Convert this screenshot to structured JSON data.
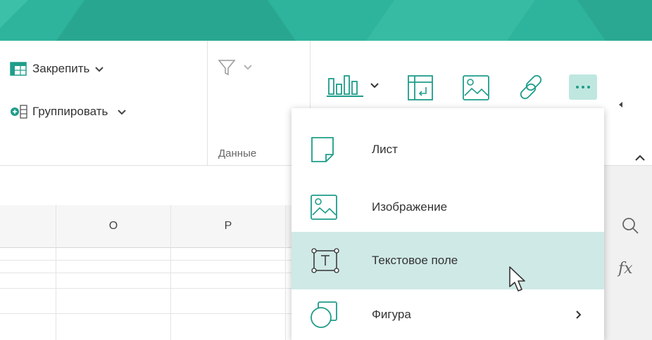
{
  "ribbon": {
    "freeze_label": "Закрепить",
    "group_label": "Группировать",
    "data_group_label": "Данные"
  },
  "sheet": {
    "columns": [
      "O",
      "P"
    ]
  },
  "insert_menu": {
    "items": [
      {
        "label": "Лист",
        "icon": "sheet-icon"
      },
      {
        "label": "Изображение",
        "icon": "image-icon"
      },
      {
        "label": "Текстовое поле",
        "icon": "text-box-icon",
        "active": true
      },
      {
        "label": "Фигура",
        "icon": "shape-icon",
        "submenu": true
      }
    ]
  },
  "side_panel": {
    "formula_label": "fx"
  },
  "colors": {
    "accent": "#2eb39c",
    "menu_highlight": "#cfe9e6",
    "icon_teal": "#1f9d8a"
  }
}
